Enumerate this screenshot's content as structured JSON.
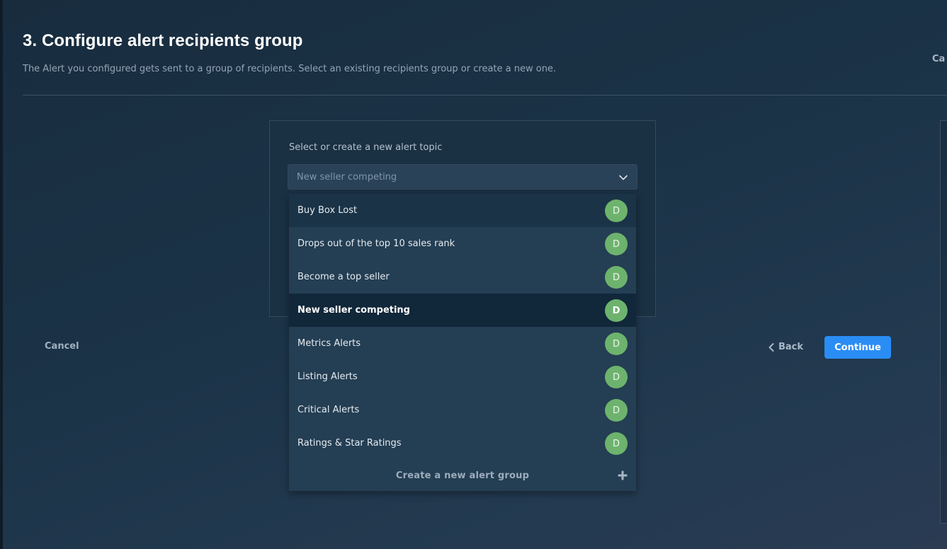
{
  "header": {
    "title": "3. Configure alert recipients group",
    "subtitle": "The Alert you configured gets sent to a group of recipients. Select an existing recipients group or create a new one.",
    "cut_off_action": "Ca"
  },
  "form": {
    "field_label": "Select or create a new alert topic",
    "selected_value": "New seller competing",
    "options": [
      {
        "label": "Buy Box Lost",
        "avatar": "D"
      },
      {
        "label": "Drops out of the top 10 sales rank",
        "avatar": "D"
      },
      {
        "label": "Become a top seller",
        "avatar": "D"
      },
      {
        "label": "New seller competing",
        "avatar": "D",
        "selected": true
      },
      {
        "label": "Metrics Alerts",
        "avatar": "D"
      },
      {
        "label": "Listing Alerts",
        "avatar": "D"
      },
      {
        "label": "Critical Alerts",
        "avatar": "D"
      },
      {
        "label": "Ratings & Star Ratings",
        "avatar": "D"
      }
    ],
    "create_label": "Create a new alert group"
  },
  "footer": {
    "cancel_label": "Cancel",
    "back_label": "Back",
    "continue_label": "Continue"
  },
  "colors": {
    "accent": "#2a8df5",
    "avatar": "#6db36e",
    "selected_row": "#11273a"
  },
  "icons": {
    "select": "chevron-down-icon",
    "create": "plus-icon",
    "back": "chevron-left-icon"
  }
}
